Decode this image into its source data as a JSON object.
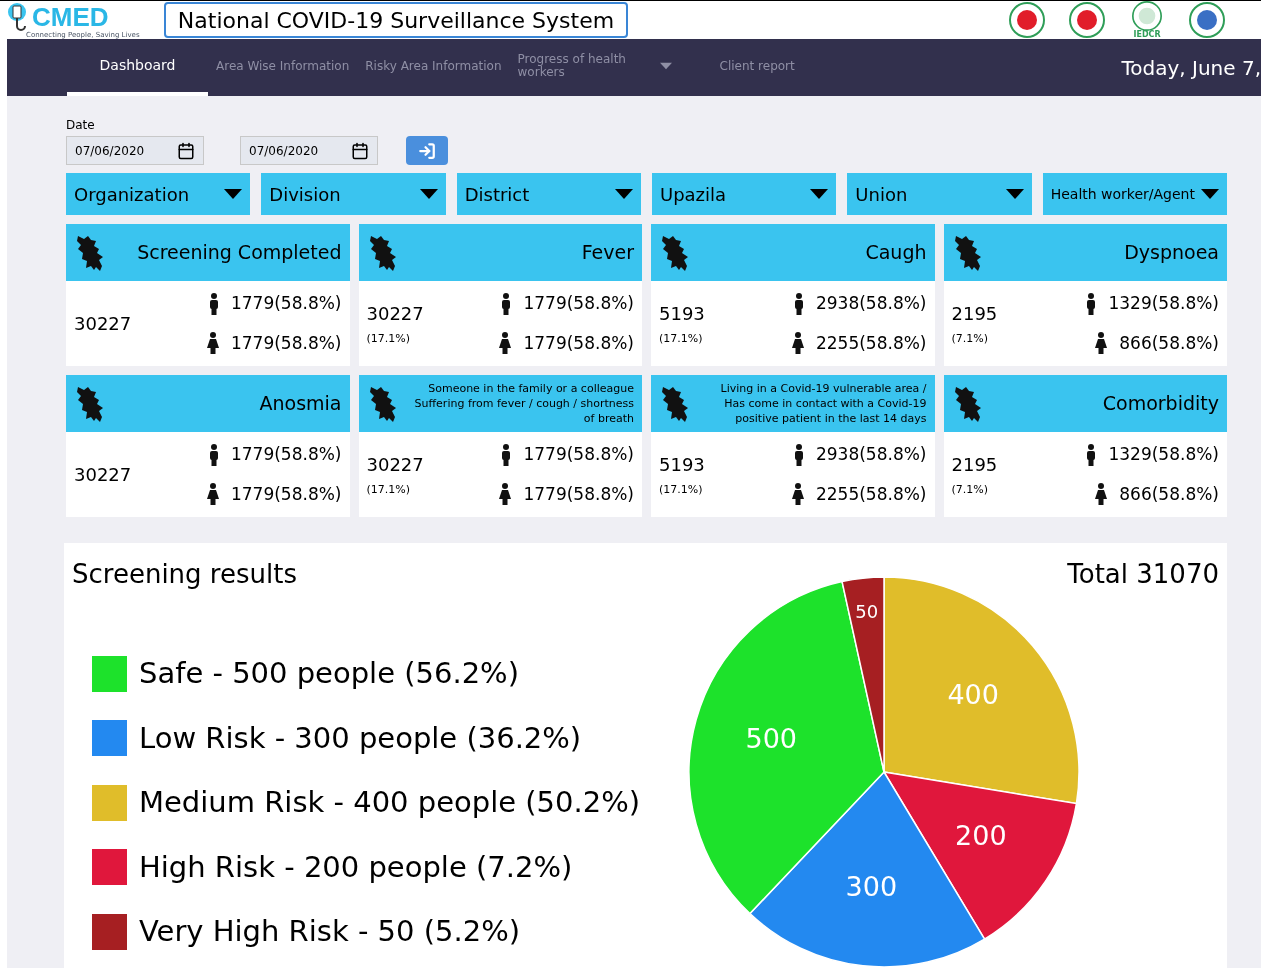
{
  "header": {
    "logo": {
      "brand": "CMED",
      "tagline": "Connecting People, Saving Lives"
    },
    "title": "National COVID-19 Surveillance System",
    "partner_logos": [
      {
        "kind": "emblem"
      },
      {
        "kind": "emblem"
      },
      {
        "kind": "institute",
        "caption": "IEDCR"
      },
      {
        "kind": "seal"
      }
    ]
  },
  "nav": {
    "items": [
      {
        "label": "Dashboard",
        "selected": true,
        "has_menu": false
      },
      {
        "label": "Area Wise Information",
        "selected": false,
        "has_menu": false
      },
      {
        "label": "Risky Area Information",
        "selected": false,
        "has_menu": false
      },
      {
        "label": "Progress of health workers",
        "selected": false,
        "has_menu": true
      },
      {
        "label": "Client report",
        "selected": false,
        "has_menu": false
      }
    ],
    "date": "Today, June 7,"
  },
  "date_filter": {
    "label": "Date",
    "from": "07/06/2020",
    "to": "07/06/2020"
  },
  "filters": [
    "Organization",
    "Division",
    "District",
    "Upazila",
    "Union",
    "Health worker/Agent"
  ],
  "cards": [
    {
      "title": "Screening Completed",
      "total": "30227",
      "male": "1779(58.8%)",
      "female": "1779(58.8%)"
    },
    {
      "title": "Fever",
      "total": "30227",
      "share": "(17.1%)",
      "male": "1779(58.8%)",
      "female": "1779(58.8%)"
    },
    {
      "title": "Caugh",
      "total": "5193",
      "share": "(17.1%)",
      "male": "2938(58.8%)",
      "female": "2255(58.8%)"
    },
    {
      "title": "Dyspnoea",
      "total": "2195",
      "share": "(7.1%)",
      "male": "1329(58.8%)",
      "female": "866(58.8%)"
    },
    {
      "title": "Anosmia",
      "total": "30227",
      "male": "1779(58.8%)",
      "female": "1779(58.8%)"
    },
    {
      "title": "Someone in the family or a colleague Suffering from fever / cough / shortness of breath",
      "total": "30227",
      "share": "(17.1%)",
      "male": "1779(58.8%)",
      "female": "1779(58.8%)"
    },
    {
      "title": "Living in a Covid-19 vulnerable area / Has come in contact with a Covid-19 positive patient in the last 14 days",
      "total": "5193",
      "share": "(17.1%)",
      "male": "2938(58.8%)",
      "female": "2255(58.8%)"
    },
    {
      "title": "Comorbidity",
      "total": "2195",
      "share": "(7.1%)",
      "male": "1329(58.8%)",
      "female": "866(58.8%)"
    }
  ],
  "screening": {
    "title": "Screening results",
    "total": "Total 31070",
    "legend": [
      {
        "label": "Safe - 500 people (56.2%)",
        "color": "#1de22b"
      },
      {
        "label": "Low Risk - 300 people (36.2%)",
        "color": "#2389f0"
      },
      {
        "label": "Medium Risk - 400 people (50.2%)",
        "color": "#e0bd2a"
      },
      {
        "label": "High Risk - 200 people (7.2%)",
        "color": "#e0173c"
      },
      {
        "label": "Very High Risk - 50 (5.2%)",
        "color": "#a61f22"
      }
    ],
    "chart_data": {
      "type": "pie",
      "values": [
        400,
        200,
        300,
        500,
        50
      ],
      "colors": [
        "#e0bd2a",
        "#e0173c",
        "#2389f0",
        "#1de22b",
        "#a61f22"
      ],
      "data_labels": true
    }
  }
}
